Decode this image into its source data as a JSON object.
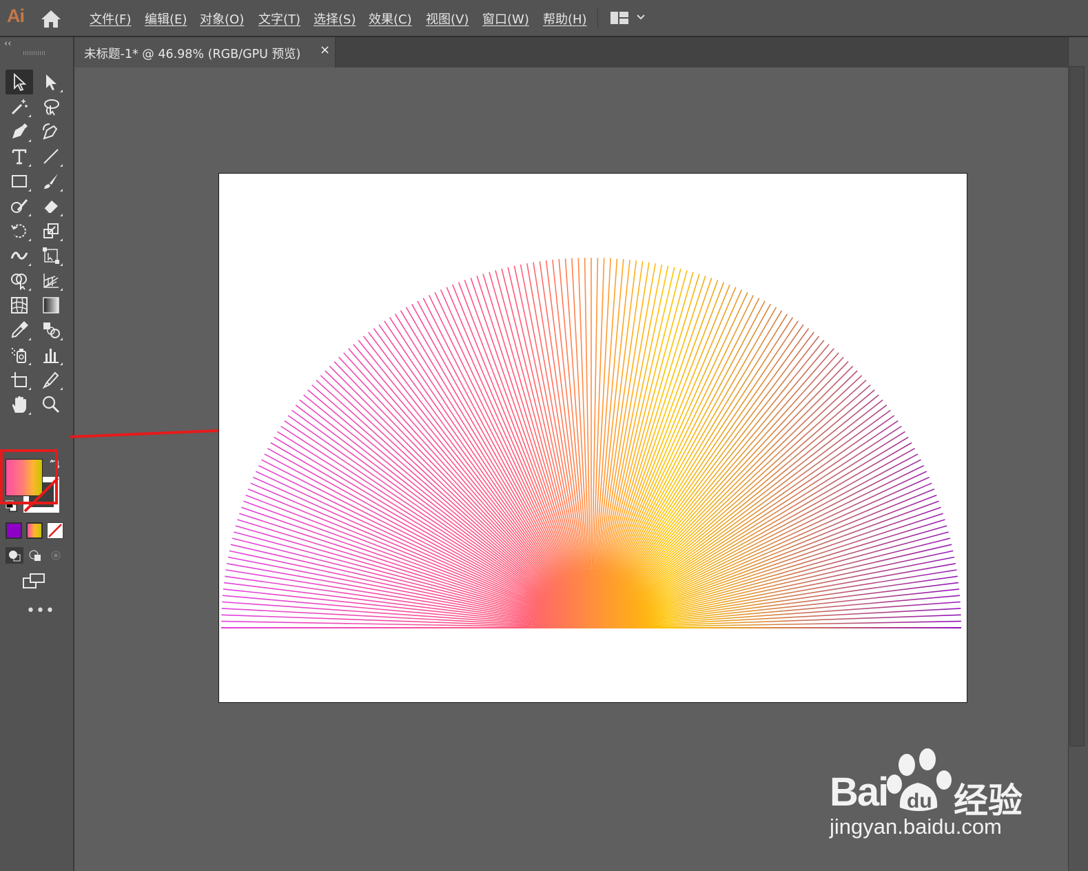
{
  "app": {
    "logo": "Ai"
  },
  "menu": {
    "items": [
      {
        "label": "文件(F)"
      },
      {
        "label": "编辑(E)"
      },
      {
        "label": "对象(O)"
      },
      {
        "label": "文字(T)"
      },
      {
        "label": "选择(S)"
      },
      {
        "label": "效果(C)"
      },
      {
        "label": "视图(V)"
      },
      {
        "label": "窗口(W)"
      },
      {
        "label": "帮助(H)"
      }
    ]
  },
  "document_tab": {
    "title": "未标题-1* @ 46.98% (RGB/GPU 预览)",
    "close": "×"
  },
  "tools": {
    "collapse": "‹‹",
    "more": "•••",
    "items": [
      "selection-tool",
      "direct-selection-tool",
      "magic-wand-tool",
      "lasso-tool",
      "pen-tool",
      "curvature-tool",
      "type-tool",
      "line-segment-tool",
      "rectangle-tool",
      "paintbrush-tool",
      "shaper-tool",
      "eraser-tool",
      "rotate-tool",
      "scale-tool",
      "width-tool",
      "free-transform-tool",
      "shape-builder-tool",
      "perspective-grid-tool",
      "mesh-tool",
      "gradient-tool",
      "eyedropper-tool",
      "blend-tool",
      "symbol-sprayer-tool",
      "column-graph-tool",
      "artboard-tool",
      "slice-tool",
      "hand-tool",
      "zoom-tool"
    ]
  },
  "colors": {
    "fill_gradient": [
      "#ff4fa0",
      "#ff7b7b",
      "#ffb530",
      "#c8c400"
    ],
    "color_mode": "#8e00c8",
    "highlight": "#e51b1b",
    "art_left": "#e040e0",
    "art_center": "#ff5a78",
    "art_right_center": "#ffc400",
    "art_right": "#9010c0"
  },
  "artwork": {
    "shape": "semicircle radial lines",
    "line_count": 180
  },
  "watermark": {
    "brand": "Bai",
    "brand_cn": "经验",
    "url": "jingyan.baidu.com"
  }
}
